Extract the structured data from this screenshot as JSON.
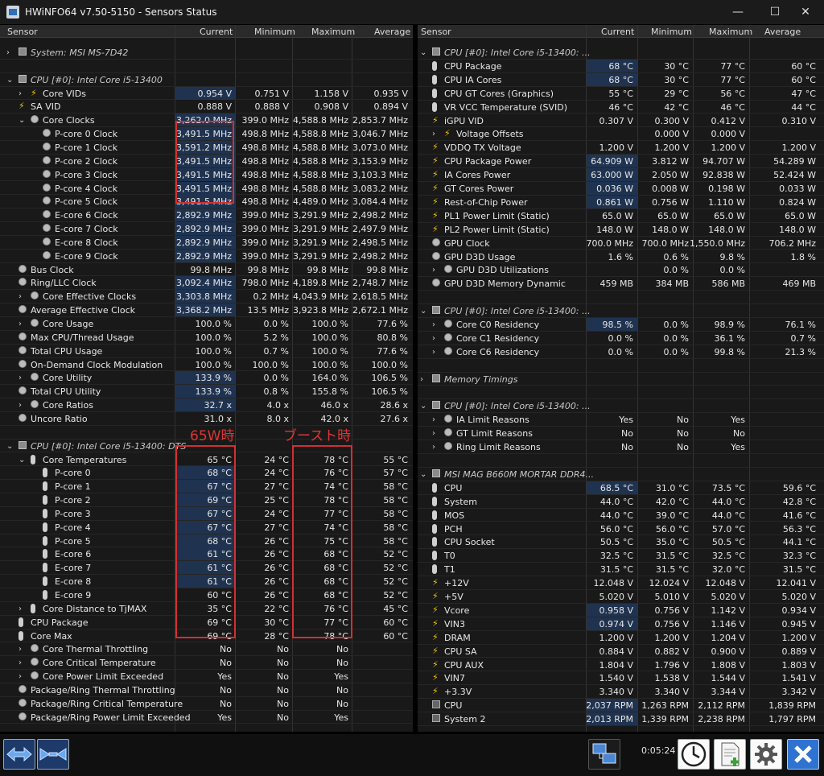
{
  "window": {
    "title": "HWiNFO64 v7.50-5150 - Sensors Status",
    "minimize": "—",
    "maximize": "☐",
    "close": "✕"
  },
  "columns": {
    "sensor": "Sensor",
    "current": "Current",
    "minimum": "Minimum",
    "maximum": "Maximum",
    "average": "Average"
  },
  "left_rows": [
    {
      "type": "group",
      "arrow": "›",
      "icon": "chip",
      "label": "System: MSI MS-7D42"
    },
    {
      "type": "blank"
    },
    {
      "type": "group",
      "arrow": "⌄",
      "icon": "chip",
      "label": "CPU [#0]: Intel Core i5-13400"
    },
    {
      "indent": 1,
      "arrow": "›",
      "icon": "bolt",
      "label": "Core VIDs",
      "cur": "0.954 V",
      "min": "0.751 V",
      "max": "1.158 V",
      "avg": "0.935 V",
      "hl": true
    },
    {
      "indent": 0,
      "icon": "bolt",
      "label": "SA VID",
      "cur": "0.888 V",
      "min": "0.888 V",
      "max": "0.908 V",
      "avg": "0.894 V"
    },
    {
      "indent": 1,
      "arrow": "⌄",
      "icon": "circ",
      "label": "Core Clocks",
      "cur": "3,262.0 MHz",
      "min": "399.0 MHz",
      "max": "4,588.8 MHz",
      "avg": "2,853.7 MHz",
      "hl": true
    },
    {
      "indent": 2,
      "icon": "circ",
      "label": "P-core 0 Clock",
      "cur": "3,491.5 MHz",
      "min": "498.8 MHz",
      "max": "4,588.8 MHz",
      "avg": "3,046.7 MHz",
      "hl": true
    },
    {
      "indent": 2,
      "icon": "circ",
      "label": "P-core 1 Clock",
      "cur": "3,591.2 MHz",
      "min": "498.8 MHz",
      "max": "4,588.8 MHz",
      "avg": "3,073.0 MHz",
      "hl": true
    },
    {
      "indent": 2,
      "icon": "circ",
      "label": "P-core 2 Clock",
      "cur": "3,491.5 MHz",
      "min": "498.8 MHz",
      "max": "4,588.8 MHz",
      "avg": "3,153.9 MHz",
      "hl": true
    },
    {
      "indent": 2,
      "icon": "circ",
      "label": "P-core 3 Clock",
      "cur": "3,491.5 MHz",
      "min": "498.8 MHz",
      "max": "4,588.8 MHz",
      "avg": "3,103.3 MHz",
      "hl": true
    },
    {
      "indent": 2,
      "icon": "circ",
      "label": "P-core 4 Clock",
      "cur": "3,491.5 MHz",
      "min": "498.8 MHz",
      "max": "4,588.8 MHz",
      "avg": "3,083.2 MHz",
      "hl": true
    },
    {
      "indent": 2,
      "icon": "circ",
      "label": "P-core 5 Clock",
      "cur": "3,491.5 MHz",
      "min": "498.8 MHz",
      "max": "4,489.0 MHz",
      "avg": "3,084.4 MHz",
      "hl": true
    },
    {
      "indent": 2,
      "icon": "circ",
      "label": "E-core 6 Clock",
      "cur": "2,892.9 MHz",
      "min": "399.0 MHz",
      "max": "3,291.9 MHz",
      "avg": "2,498.2 MHz",
      "hl": true
    },
    {
      "indent": 2,
      "icon": "circ",
      "label": "E-core 7 Clock",
      "cur": "2,892.9 MHz",
      "min": "399.0 MHz",
      "max": "3,291.9 MHz",
      "avg": "2,497.9 MHz",
      "hl": true
    },
    {
      "indent": 2,
      "icon": "circ",
      "label": "E-core 8 Clock",
      "cur": "2,892.9 MHz",
      "min": "399.0 MHz",
      "max": "3,291.9 MHz",
      "avg": "2,498.5 MHz",
      "hl": true
    },
    {
      "indent": 2,
      "icon": "circ",
      "label": "E-core 9 Clock",
      "cur": "2,892.9 MHz",
      "min": "399.0 MHz",
      "max": "3,291.9 MHz",
      "avg": "2,498.2 MHz",
      "hl": true
    },
    {
      "indent": 0,
      "icon": "circ",
      "label": "Bus Clock",
      "cur": "99.8 MHz",
      "min": "99.8 MHz",
      "max": "99.8 MHz",
      "avg": "99.8 MHz"
    },
    {
      "indent": 0,
      "icon": "circ",
      "label": "Ring/LLC Clock",
      "cur": "3,092.4 MHz",
      "min": "798.0 MHz",
      "max": "4,189.8 MHz",
      "avg": "2,748.7 MHz",
      "hl": true
    },
    {
      "indent": 1,
      "arrow": "›",
      "icon": "circ",
      "label": "Core Effective Clocks",
      "cur": "3,303.8 MHz",
      "min": "0.2 MHz",
      "max": "4,043.9 MHz",
      "avg": "2,618.5 MHz",
      "hl": true
    },
    {
      "indent": 0,
      "icon": "circ",
      "label": "Average Effective Clock",
      "cur": "3,368.2 MHz",
      "min": "13.5 MHz",
      "max": "3,923.8 MHz",
      "avg": "2,672.1 MHz",
      "hl": true
    },
    {
      "indent": 1,
      "arrow": "›",
      "icon": "circ",
      "label": "Core Usage",
      "cur": "100.0 %",
      "min": "0.0 %",
      "max": "100.0 %",
      "avg": "77.6 %"
    },
    {
      "indent": 0,
      "icon": "circ",
      "label": "Max CPU/Thread Usage",
      "cur": "100.0 %",
      "min": "5.2 %",
      "max": "100.0 %",
      "avg": "80.8 %"
    },
    {
      "indent": 0,
      "icon": "circ",
      "label": "Total CPU Usage",
      "cur": "100.0 %",
      "min": "0.7 %",
      "max": "100.0 %",
      "avg": "77.6 %"
    },
    {
      "indent": 0,
      "icon": "circ",
      "label": "On-Demand Clock Modulation",
      "cur": "100.0 %",
      "min": "100.0 %",
      "max": "100.0 %",
      "avg": "100.0 %"
    },
    {
      "indent": 1,
      "arrow": "›",
      "icon": "circ",
      "label": "Core Utility",
      "cur": "133.9 %",
      "min": "0.0 %",
      "max": "164.0 %",
      "avg": "106.5 %",
      "hl": true
    },
    {
      "indent": 0,
      "icon": "circ",
      "label": "Total CPU Utility",
      "cur": "133.9 %",
      "min": "0.8 %",
      "max": "155.8 %",
      "avg": "106.5 %",
      "hl": true
    },
    {
      "indent": 1,
      "arrow": "›",
      "icon": "circ",
      "label": "Core Ratios",
      "cur": "32.7 x",
      "min": "4.0 x",
      "max": "46.0 x",
      "avg": "28.6 x",
      "hl": true
    },
    {
      "indent": 0,
      "icon": "circ",
      "label": "Uncore Ratio",
      "cur": "31.0 x",
      "min": "8.0 x",
      "max": "42.0 x",
      "avg": "27.6 x"
    },
    {
      "type": "blank"
    },
    {
      "type": "group",
      "arrow": "⌄",
      "icon": "chip",
      "label": "CPU [#0]: Intel Core i5-13400: DTS"
    },
    {
      "indent": 1,
      "arrow": "⌄",
      "icon": "therm",
      "label": "Core Temperatures",
      "cur": "65 °C",
      "min": "24 °C",
      "max": "78 °C",
      "avg": "55 °C"
    },
    {
      "indent": 2,
      "icon": "therm",
      "label": "P-core 0",
      "cur": "68 °C",
      "min": "24 °C",
      "max": "76 °C",
      "avg": "57 °C",
      "hl": true
    },
    {
      "indent": 2,
      "icon": "therm",
      "label": "P-core 1",
      "cur": "67 °C",
      "min": "27 °C",
      "max": "74 °C",
      "avg": "58 °C",
      "hl": true
    },
    {
      "indent": 2,
      "icon": "therm",
      "label": "P-core 2",
      "cur": "69 °C",
      "min": "25 °C",
      "max": "78 °C",
      "avg": "58 °C",
      "hl": true
    },
    {
      "indent": 2,
      "icon": "therm",
      "label": "P-core 3",
      "cur": "67 °C",
      "min": "24 °C",
      "max": "77 °C",
      "avg": "58 °C",
      "hl": true
    },
    {
      "indent": 2,
      "icon": "therm",
      "label": "P-core 4",
      "cur": "67 °C",
      "min": "27 °C",
      "max": "74 °C",
      "avg": "58 °C",
      "hl": true
    },
    {
      "indent": 2,
      "icon": "therm",
      "label": "P-core 5",
      "cur": "68 °C",
      "min": "26 °C",
      "max": "75 °C",
      "avg": "58 °C",
      "hl": true
    },
    {
      "indent": 2,
      "icon": "therm",
      "label": "E-core 6",
      "cur": "61 °C",
      "min": "26 °C",
      "max": "68 °C",
      "avg": "52 °C",
      "hl": true
    },
    {
      "indent": 2,
      "icon": "therm",
      "label": "E-core 7",
      "cur": "61 °C",
      "min": "26 °C",
      "max": "68 °C",
      "avg": "52 °C",
      "hl": true
    },
    {
      "indent": 2,
      "icon": "therm",
      "label": "E-core 8",
      "cur": "61 °C",
      "min": "26 °C",
      "max": "68 °C",
      "avg": "52 °C",
      "hl": true
    },
    {
      "indent": 2,
      "icon": "therm",
      "label": "E-core 9",
      "cur": "60 °C",
      "min": "26 °C",
      "max": "68 °C",
      "avg": "52 °C"
    },
    {
      "indent": 1,
      "arrow": "›",
      "icon": "therm",
      "label": "Core Distance to TjMAX",
      "cur": "35 °C",
      "min": "22 °C",
      "max": "76 °C",
      "avg": "45 °C"
    },
    {
      "indent": 0,
      "icon": "therm",
      "label": "CPU Package",
      "cur": "69 °C",
      "min": "30 °C",
      "max": "77 °C",
      "avg": "60 °C"
    },
    {
      "indent": 0,
      "icon": "therm",
      "label": "Core Max",
      "cur": "69 °C",
      "min": "28 °C",
      "max": "78 °C",
      "avg": "60 °C"
    },
    {
      "indent": 1,
      "arrow": "›",
      "icon": "circ",
      "label": "Core Thermal Throttling",
      "cur": "No",
      "min": "No",
      "max": "No",
      "avg": ""
    },
    {
      "indent": 1,
      "arrow": "›",
      "icon": "circ",
      "label": "Core Critical Temperature",
      "cur": "No",
      "min": "No",
      "max": "No",
      "avg": ""
    },
    {
      "indent": 1,
      "arrow": "›",
      "icon": "circ",
      "label": "Core Power Limit Exceeded",
      "cur": "Yes",
      "min": "No",
      "max": "Yes",
      "avg": ""
    },
    {
      "indent": 0,
      "icon": "circ",
      "label": "Package/Ring Thermal Throttling",
      "cur": "No",
      "min": "No",
      "max": "No",
      "avg": ""
    },
    {
      "indent": 0,
      "icon": "circ",
      "label": "Package/Ring Critical Temperature",
      "cur": "No",
      "min": "No",
      "max": "No",
      "avg": ""
    },
    {
      "indent": 0,
      "icon": "circ",
      "label": "Package/Ring Power Limit Exceeded",
      "cur": "Yes",
      "min": "No",
      "max": "Yes",
      "avg": ""
    }
  ],
  "right_rows": [
    {
      "type": "group",
      "arrow": "⌄",
      "icon": "chip",
      "label": "CPU [#0]: Intel Core i5-13400: ..."
    },
    {
      "indent": 0,
      "icon": "therm",
      "label": "CPU Package",
      "cur": "68 °C",
      "min": "30 °C",
      "max": "77 °C",
      "avg": "60 °C",
      "hl": true
    },
    {
      "indent": 0,
      "icon": "therm",
      "label": "CPU IA Cores",
      "cur": "68 °C",
      "min": "30 °C",
      "max": "77 °C",
      "avg": "60 °C",
      "hl": true
    },
    {
      "indent": 0,
      "icon": "therm",
      "label": "CPU GT Cores (Graphics)",
      "cur": "55 °C",
      "min": "29 °C",
      "max": "56 °C",
      "avg": "47 °C"
    },
    {
      "indent": 0,
      "icon": "therm",
      "label": "VR VCC Temperature (SVID)",
      "cur": "46 °C",
      "min": "42 °C",
      "max": "46 °C",
      "avg": "44 °C"
    },
    {
      "indent": 0,
      "icon": "bolt",
      "label": "iGPU VID",
      "cur": "0.307 V",
      "min": "0.300 V",
      "max": "0.412 V",
      "avg": "0.310 V"
    },
    {
      "indent": 1,
      "arrow": "›",
      "icon": "bolt",
      "label": "Voltage Offsets",
      "cur": "",
      "min": "0.000 V",
      "max": "0.000 V",
      "avg": ""
    },
    {
      "indent": 0,
      "icon": "bolt",
      "label": "VDDQ TX Voltage",
      "cur": "1.200 V",
      "min": "1.200 V",
      "max": "1.200 V",
      "avg": "1.200 V"
    },
    {
      "indent": 0,
      "icon": "bolt",
      "label": "CPU Package Power",
      "cur": "64.909 W",
      "min": "3.812 W",
      "max": "94.707 W",
      "avg": "54.289 W",
      "hl": true
    },
    {
      "indent": 0,
      "icon": "bolt",
      "label": "IA Cores Power",
      "cur": "63.000 W",
      "min": "2.050 W",
      "max": "92.838 W",
      "avg": "52.424 W",
      "hl": true
    },
    {
      "indent": 0,
      "icon": "bolt",
      "label": "GT Cores Power",
      "cur": "0.036 W",
      "min": "0.008 W",
      "max": "0.198 W",
      "avg": "0.033 W",
      "hl": true
    },
    {
      "indent": 0,
      "icon": "bolt",
      "label": "Rest-of-Chip Power",
      "cur": "0.861 W",
      "min": "0.756 W",
      "max": "1.110 W",
      "avg": "0.824 W",
      "hl": true
    },
    {
      "indent": 0,
      "icon": "bolt",
      "label": "PL1 Power Limit (Static)",
      "cur": "65.0 W",
      "min": "65.0 W",
      "max": "65.0 W",
      "avg": "65.0 W"
    },
    {
      "indent": 0,
      "icon": "bolt",
      "label": "PL2 Power Limit (Static)",
      "cur": "148.0 W",
      "min": "148.0 W",
      "max": "148.0 W",
      "avg": "148.0 W"
    },
    {
      "indent": 0,
      "icon": "circ",
      "label": "GPU Clock",
      "cur": "700.0 MHz",
      "min": "700.0 MHz",
      "max": "1,550.0 MHz",
      "avg": "706.2 MHz"
    },
    {
      "indent": 0,
      "icon": "circ",
      "label": "GPU D3D Usage",
      "cur": "1.6 %",
      "min": "0.6 %",
      "max": "9.8 %",
      "avg": "1.8 %"
    },
    {
      "indent": 1,
      "arrow": "›",
      "icon": "circ",
      "label": "GPU D3D Utilizations",
      "cur": "",
      "min": "0.0 %",
      "max": "0.0 %",
      "avg": ""
    },
    {
      "indent": 0,
      "icon": "circ",
      "label": "GPU D3D Memory Dynamic",
      "cur": "459 MB",
      "min": "384 MB",
      "max": "586 MB",
      "avg": "469 MB"
    },
    {
      "type": "blank"
    },
    {
      "type": "group",
      "arrow": "⌄",
      "icon": "chip",
      "label": "CPU [#0]: Intel Core i5-13400: ..."
    },
    {
      "indent": 1,
      "arrow": "›",
      "icon": "circ",
      "label": "Core C0 Residency",
      "cur": "98.5 %",
      "min": "0.0 %",
      "max": "98.9 %",
      "avg": "76.1 %",
      "hl": true
    },
    {
      "indent": 1,
      "arrow": "›",
      "icon": "circ",
      "label": "Core C1 Residency",
      "cur": "0.0 %",
      "min": "0.0 %",
      "max": "36.1 %",
      "avg": "0.7 %"
    },
    {
      "indent": 1,
      "arrow": "›",
      "icon": "circ",
      "label": "Core C6 Residency",
      "cur": "0.0 %",
      "min": "0.0 %",
      "max": "99.8 %",
      "avg": "21.3 %"
    },
    {
      "type": "blank"
    },
    {
      "type": "group",
      "arrow": "›",
      "icon": "chip",
      "label": "Memory Timings"
    },
    {
      "type": "blank"
    },
    {
      "type": "group",
      "arrow": "⌄",
      "icon": "chip",
      "label": "CPU [#0]: Intel Core i5-13400: ..."
    },
    {
      "indent": 1,
      "arrow": "›",
      "icon": "circ",
      "label": "IA Limit Reasons",
      "cur": "Yes",
      "min": "No",
      "max": "Yes",
      "avg": ""
    },
    {
      "indent": 1,
      "arrow": "›",
      "icon": "circ",
      "label": "GT Limit Reasons",
      "cur": "No",
      "min": "No",
      "max": "No",
      "avg": ""
    },
    {
      "indent": 1,
      "arrow": "›",
      "icon": "circ",
      "label": "Ring Limit Reasons",
      "cur": "No",
      "min": "No",
      "max": "Yes",
      "avg": ""
    },
    {
      "type": "blank"
    },
    {
      "type": "group",
      "arrow": "⌄",
      "icon": "chip",
      "label": "MSI MAG B660M MORTAR DDR4..."
    },
    {
      "indent": 0,
      "icon": "therm",
      "label": "CPU",
      "cur": "68.5 °C",
      "min": "31.0 °C",
      "max": "73.5 °C",
      "avg": "59.6 °C",
      "hl": true
    },
    {
      "indent": 0,
      "icon": "therm",
      "label": "System",
      "cur": "44.0 °C",
      "min": "42.0 °C",
      "max": "44.0 °C",
      "avg": "42.8 °C"
    },
    {
      "indent": 0,
      "icon": "therm",
      "label": "MOS",
      "cur": "44.0 °C",
      "min": "39.0 °C",
      "max": "44.0 °C",
      "avg": "41.6 °C"
    },
    {
      "indent": 0,
      "icon": "therm",
      "label": "PCH",
      "cur": "56.0 °C",
      "min": "56.0 °C",
      "max": "57.0 °C",
      "avg": "56.3 °C"
    },
    {
      "indent": 0,
      "icon": "therm",
      "label": "CPU Socket",
      "cur": "50.5 °C",
      "min": "35.0 °C",
      "max": "50.5 °C",
      "avg": "44.1 °C"
    },
    {
      "indent": 0,
      "icon": "therm",
      "label": "T0",
      "cur": "32.5 °C",
      "min": "31.5 °C",
      "max": "32.5 °C",
      "avg": "32.3 °C"
    },
    {
      "indent": 0,
      "icon": "therm",
      "label": "T1",
      "cur": "31.5 °C",
      "min": "31.5 °C",
      "max": "32.0 °C",
      "avg": "31.5 °C"
    },
    {
      "indent": 0,
      "icon": "bolt",
      "label": "+12V",
      "cur": "12.048 V",
      "min": "12.024 V",
      "max": "12.048 V",
      "avg": "12.041 V"
    },
    {
      "indent": 0,
      "icon": "bolt",
      "label": "+5V",
      "cur": "5.020 V",
      "min": "5.010 V",
      "max": "5.020 V",
      "avg": "5.020 V"
    },
    {
      "indent": 0,
      "icon": "bolt",
      "label": "Vcore",
      "cur": "0.958 V",
      "min": "0.756 V",
      "max": "1.142 V",
      "avg": "0.934 V",
      "hl": true
    },
    {
      "indent": 0,
      "icon": "bolt",
      "label": "VIN3",
      "cur": "0.974 V",
      "min": "0.756 V",
      "max": "1.146 V",
      "avg": "0.945 V",
      "hl": true
    },
    {
      "indent": 0,
      "icon": "bolt",
      "label": "DRAM",
      "cur": "1.200 V",
      "min": "1.200 V",
      "max": "1.204 V",
      "avg": "1.200 V"
    },
    {
      "indent": 0,
      "icon": "bolt",
      "label": "CPU SA",
      "cur": "0.884 V",
      "min": "0.882 V",
      "max": "0.900 V",
      "avg": "0.889 V"
    },
    {
      "indent": 0,
      "icon": "bolt",
      "label": "CPU AUX",
      "cur": "1.804 V",
      "min": "1.796 V",
      "max": "1.808 V",
      "avg": "1.803 V"
    },
    {
      "indent": 0,
      "icon": "bolt",
      "label": "VIN7",
      "cur": "1.540 V",
      "min": "1.538 V",
      "max": "1.544 V",
      "avg": "1.541 V"
    },
    {
      "indent": 0,
      "icon": "bolt",
      "label": "+3.3V",
      "cur": "3.340 V",
      "min": "3.340 V",
      "max": "3.344 V",
      "avg": "3.342 V"
    },
    {
      "indent": 0,
      "icon": "fan",
      "label": "CPU",
      "cur": "2,037 RPM",
      "min": "1,263 RPM",
      "max": "2,112 RPM",
      "avg": "1,839 RPM",
      "hl": true
    },
    {
      "indent": 0,
      "icon": "fan",
      "label": "System 2",
      "cur": "2,013 RPM",
      "min": "1,339 RPM",
      "max": "2,238 RPM",
      "avg": "1,797 RPM",
      "hl": true
    }
  ],
  "annotations": {
    "label_65w": "65W時",
    "label_boost": "ブースト時"
  },
  "footer": {
    "timer": "0:05:24"
  },
  "colors": {
    "current_highlight": "#1f3350",
    "annotation_red": "#d23030"
  }
}
